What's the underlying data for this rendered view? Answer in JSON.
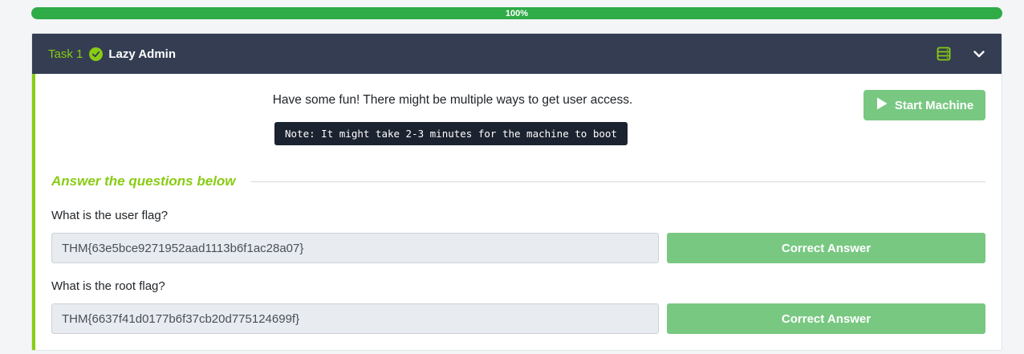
{
  "progress": {
    "label": "100%",
    "fraction": 1.0
  },
  "task": {
    "number_label": "Task 1",
    "title": "Lazy Admin",
    "completed": true
  },
  "content": {
    "description": "Have some fun! There might be multiple ways to get user access.",
    "note": "Note: It might take 2-3 minutes for the machine to boot",
    "start_button": "Start Machine"
  },
  "questions_heading": "Answer the questions below",
  "questions": [
    {
      "question": "What is the user flag?",
      "answer": "THM{63e5bce9271952aad1113b6f1ac28a07}",
      "button": "Correct Answer"
    },
    {
      "question": "What is the root flag?",
      "answer": "THM{6637f41d0177b6f37cb20d775124699f}",
      "button": "Correct Answer"
    }
  ],
  "icons": {
    "task_status": "check-circle-icon",
    "header_left": "server-icon",
    "header_right": "chevron-down-icon",
    "start": "play-icon"
  },
  "colors": {
    "accent": "#88cc14",
    "progress": "#2fab48",
    "header_bg": "#343d52",
    "success_button": "#78c882"
  }
}
